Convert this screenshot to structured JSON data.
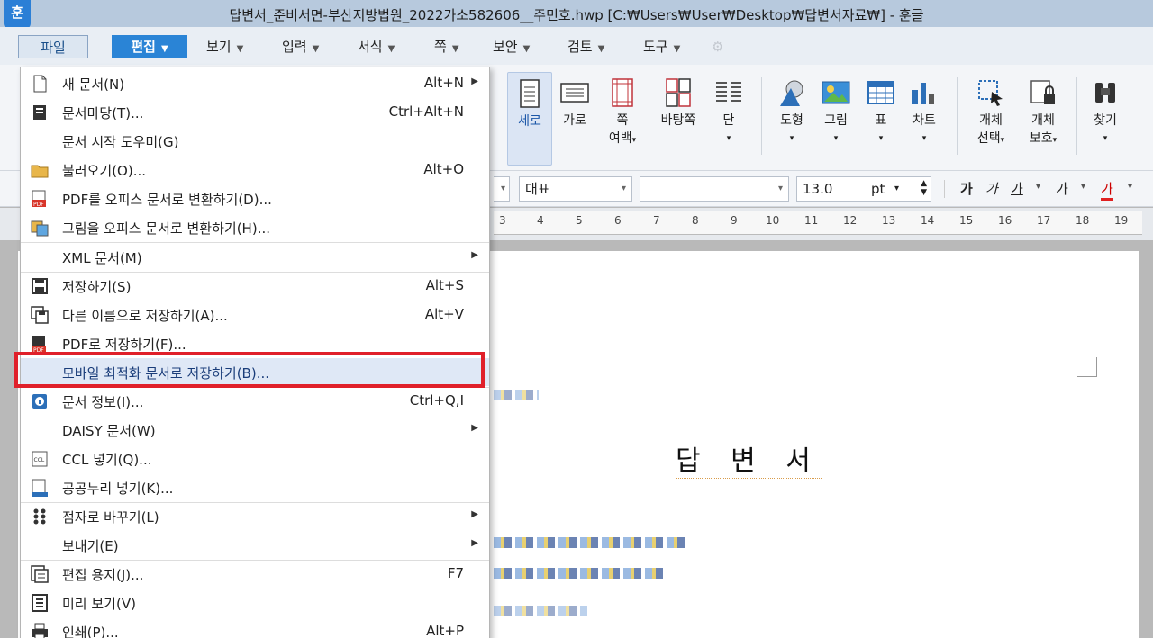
{
  "window": {
    "title": "답변서_준비서면-부산지방법원_2022가소582606__주민호.hwp [C:₩Users₩User₩Desktop₩답변서자료₩] - 훈글",
    "app_icon": "훈"
  },
  "menubar": {
    "items": [
      "파일",
      "편집",
      "보기",
      "입력",
      "서식",
      "쪽",
      "보안",
      "검토",
      "도구"
    ]
  },
  "ribbon": {
    "buttons": [
      {
        "label": "세로",
        "icon": "portrait-page-icon"
      },
      {
        "label": "가로",
        "icon": "landscape-page-icon"
      },
      {
        "label": "쪽",
        "label2": "여백",
        "icon": "page-margin-icon"
      },
      {
        "label": "바탕쪽",
        "icon": "master-page-icon"
      },
      {
        "label": "단",
        "icon": "columns-icon"
      },
      {
        "label": "도형",
        "icon": "shapes-icon"
      },
      {
        "label": "그림",
        "icon": "picture-icon"
      },
      {
        "label": "표",
        "icon": "table-icon"
      },
      {
        "label": "차트",
        "icon": "chart-icon"
      },
      {
        "label": "개체",
        "label2": "선택",
        "icon": "object-select-icon"
      },
      {
        "label": "개체",
        "label2": "보호",
        "icon": "object-protect-icon"
      },
      {
        "label": "찾기",
        "icon": "binoculars-icon"
      }
    ]
  },
  "format": {
    "style": "대표",
    "font_size": "13.0",
    "unit": "pt",
    "text_buttons": [
      "가",
      "가",
      "가",
      "가",
      "가"
    ]
  },
  "ruler": {
    "numbers": [
      "3",
      "4",
      "5",
      "6",
      "7",
      "8",
      "9",
      "10",
      "11",
      "12",
      "13",
      "14",
      "15",
      "16",
      "17",
      "18",
      "19"
    ]
  },
  "document": {
    "heading": "답 변 서"
  },
  "file_menu": {
    "items": [
      {
        "label": "새 문서(N)",
        "shortcut": "Alt+N",
        "submenu": true,
        "icon": "new-document-icon"
      },
      {
        "label": "문서마당(T)...",
        "shortcut": "Ctrl+Alt+N",
        "icon": "template-icon"
      },
      {
        "label": "문서 시작 도우미(G)",
        "shortcut": "",
        "icon": ""
      },
      {
        "label": "불러오기(O)...",
        "shortcut": "Alt+O",
        "icon": "open-folder-icon"
      },
      {
        "label": "PDF를 오피스 문서로 변환하기(D)...",
        "shortcut": "",
        "icon": "pdf-convert-icon"
      },
      {
        "label": "그림을 오피스 문서로 변환하기(H)...",
        "shortcut": "",
        "icon": "image-convert-icon"
      },
      {
        "label": "XML 문서(M)",
        "shortcut": "",
        "submenu": true,
        "icon": ""
      },
      {
        "label": "저장하기(S)",
        "shortcut": "Alt+S",
        "icon": "save-icon"
      },
      {
        "label": "다른 이름으로 저장하기(A)...",
        "shortcut": "Alt+V",
        "icon": "save-as-icon"
      },
      {
        "label": "PDF로 저장하기(F)...",
        "shortcut": "",
        "icon": "save-pdf-icon"
      },
      {
        "label": "모바일 최적화 문서로 저장하기(B)...",
        "shortcut": "",
        "icon": "",
        "highlighted": true
      },
      {
        "label": "문서 정보(I)...",
        "shortcut": "Ctrl+Q,I",
        "icon": "info-icon"
      },
      {
        "label": "DAISY 문서(W)",
        "shortcut": "",
        "submenu": true,
        "icon": ""
      },
      {
        "label": "CCL 넣기(Q)...",
        "shortcut": "",
        "icon": "ccl-icon"
      },
      {
        "label": "공공누리 넣기(K)...",
        "shortcut": "",
        "icon": "open-license-icon"
      },
      {
        "label": "점자로 바꾸기(L)",
        "shortcut": "",
        "submenu": true,
        "icon": "braille-icon"
      },
      {
        "label": "보내기(E)",
        "shortcut": "",
        "submenu": true,
        "icon": ""
      },
      {
        "label": "편집 용지(J)...",
        "shortcut": "F7",
        "icon": "page-setup-icon"
      },
      {
        "label": "미리 보기(V)",
        "shortcut": "",
        "icon": "preview-icon"
      },
      {
        "label": "인쇄(P)...",
        "shortcut": "Alt+P",
        "icon": "print-icon"
      }
    ]
  },
  "colors": {
    "accent": "#2a84d6",
    "highlight_box": "#e0202a"
  }
}
